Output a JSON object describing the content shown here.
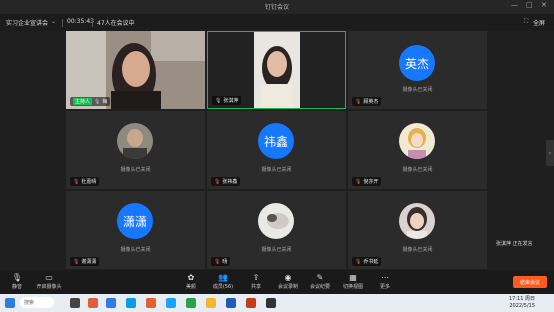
{
  "titlebar": {
    "title": "钉钉会议",
    "minimize": "—",
    "maximize": "□",
    "close": "✕"
  },
  "infobar": {
    "meeting_name": "实习企业宣讲会",
    "duration": "00:35:43",
    "attendees": "47人在会议中",
    "fullscreen": "全屏"
  },
  "tiles": [
    {
      "name": "梅",
      "host_label": "主持人",
      "muted": false,
      "type": "video1"
    },
    {
      "name": "张淇萍",
      "muted": false,
      "type": "video2",
      "active": true
    },
    {
      "name": "顾英杰",
      "avatar_text": "英杰",
      "cam_off": "摄像头已关闭",
      "muted": true,
      "type": "text"
    },
    {
      "name": "杜嘉晴",
      "cam_off": "摄像头已关闭",
      "muted": true,
      "type": "photo1"
    },
    {
      "name": "张祎鑫",
      "avatar_text": "祎鑫",
      "cam_off": "摄像头已关闭",
      "muted": true,
      "type": "text"
    },
    {
      "name": "倪亦开",
      "cam_off": "摄像头已关闭",
      "muted": true,
      "type": "photo2"
    },
    {
      "name": "谢潇潇",
      "avatar_text": "潇潇",
      "cam_off": "摄像头已关闭",
      "muted": true,
      "type": "text"
    },
    {
      "name": "旸",
      "cam_off": "摄像头已关闭",
      "muted": true,
      "type": "photo3"
    },
    {
      "name": "乔书延",
      "cam_off": "摄像头已关闭",
      "muted": true,
      "type": "photo4"
    }
  ],
  "speaking": "张淇萍  正在发言",
  "toolbar": {
    "mute": "静音",
    "camera": "开启摄像头",
    "beauty": "美颜",
    "members": "成员(56)",
    "share": "共享",
    "record": "会议录制",
    "minutes": "会议纪要",
    "layout": "切换视图",
    "more": "更多",
    "end": "结束会议"
  },
  "taskbar": {
    "search": "搜索",
    "time": "17:11 周日",
    "date": "2022/5/15"
  },
  "colors": {
    "accent": "#1677ff",
    "active_border": "#1db954",
    "end_button": "#ff5a1f"
  }
}
